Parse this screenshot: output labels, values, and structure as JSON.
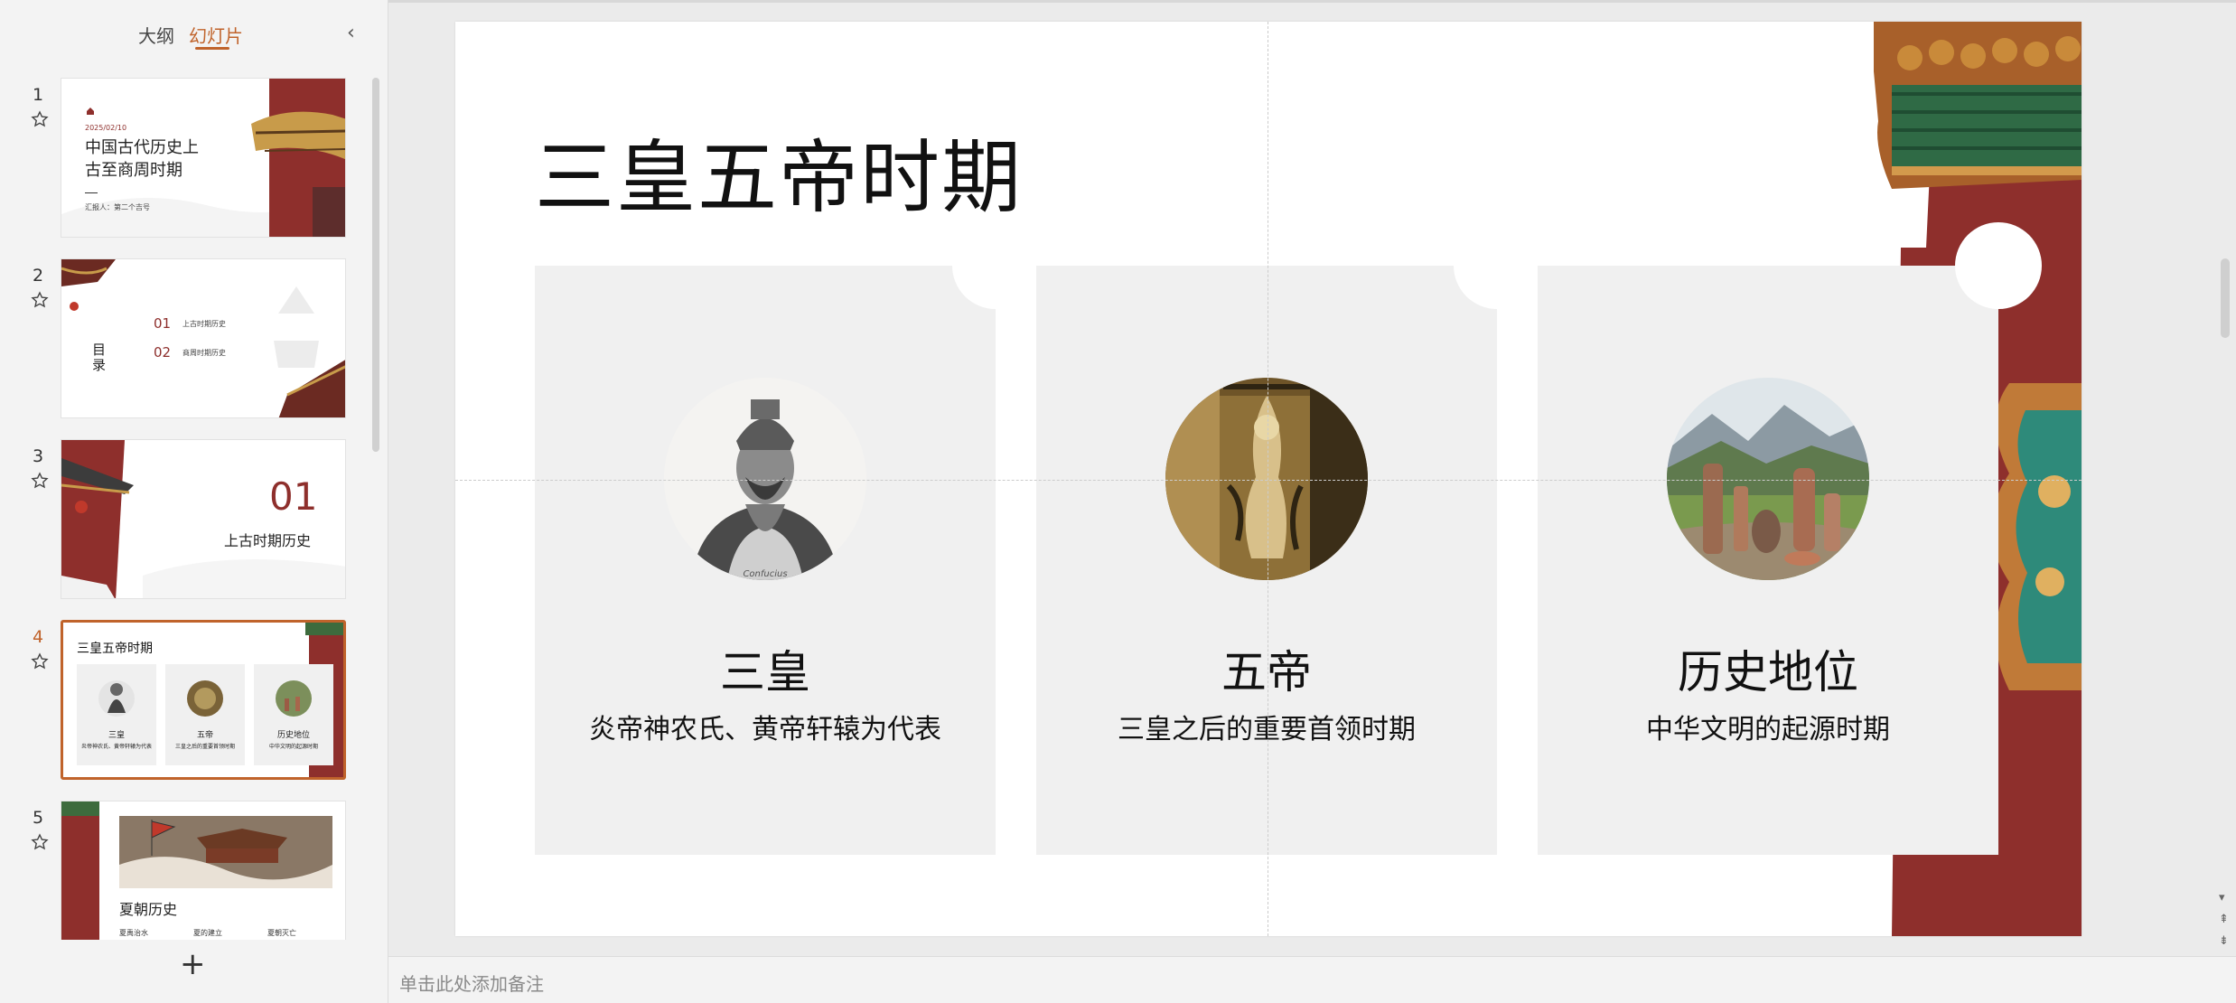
{
  "panel": {
    "tabs": {
      "outline": "大纲",
      "slides": "幻灯片"
    },
    "thumbnails": [
      {
        "num": "1",
        "date": "2025/02/10",
        "title": "中国古代历史上古至商周时期",
        "line1": "中国古代历史上",
        "line2": "古至商周时期",
        "reporter": "汇报人：第二个吉号"
      },
      {
        "num": "2",
        "toc_title": "目录",
        "items": [
          {
            "n": "01",
            "t": "上古时期历史"
          },
          {
            "n": "02",
            "t": "商周时期历史"
          }
        ]
      },
      {
        "num": "3",
        "n": "01",
        "t": "上古时期历史"
      },
      {
        "num": "4",
        "title": "三皇五帝时期",
        "cards": [
          {
            "h": "三皇",
            "p": "炎帝神农氏、黄帝轩辕为代表"
          },
          {
            "h": "五帝",
            "p": "三皇之后的重要首领时期"
          },
          {
            "h": "历史地位",
            "p": "中华文明的起源时期"
          }
        ]
      },
      {
        "num": "5",
        "title": "夏朝历史",
        "cols": [
          "夏禹治水",
          "夏的建立",
          "夏朝灭亡"
        ]
      }
    ],
    "add_label": "+"
  },
  "slide": {
    "title": "三皇五帝时期",
    "cards": [
      {
        "heading": "三皇",
        "text": "炎帝神农氏、黄帝轩辕为代表",
        "image": "confucius-portrait"
      },
      {
        "heading": "五帝",
        "text": "三皇之后的重要首领时期",
        "image": "carved-relief"
      },
      {
        "heading": "历史地位",
        "text": "中华文明的起源时期",
        "image": "pottery-landscape"
      }
    ],
    "decor": "palace-pillar",
    "engraving_caption": "Confucius"
  },
  "notes": {
    "placeholder": "单击此处添加备注"
  },
  "colors": {
    "accent": "#c0632b",
    "pillar": "#8e2f2c"
  }
}
